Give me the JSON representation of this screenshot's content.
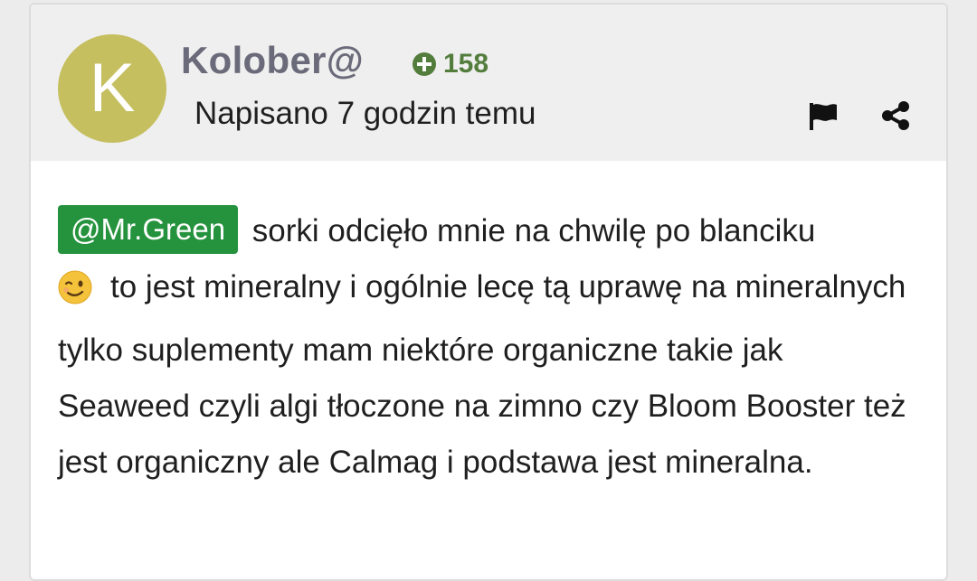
{
  "post": {
    "avatar_letter": "K",
    "avatar_color": "#c5bf60",
    "username": "Kolober@",
    "reputation": "158",
    "posted_time": "Napisano 7 godzin temu",
    "actions": {
      "report_icon": "flag-icon",
      "share_icon": "share-icon"
    },
    "mention": "@Mr.Green",
    "text_part1": " sorki odcięło mnie na chwilę po blanciku",
    "emoji": "winking-face-emoji",
    "text_part2": "to jest mineralny i ogólnie lecę tą uprawę na mineralnych tylko suplementy mam niektóre organiczne takie jak Seaweed czyli algi tłoczone na zimno czy Bloom Booster też jest organiczny ale Calmag i podstawa jest mineralna."
  },
  "colors": {
    "mention_bg": "#25923d",
    "reputation": "#537d3c",
    "username": "#6a6a7a"
  }
}
